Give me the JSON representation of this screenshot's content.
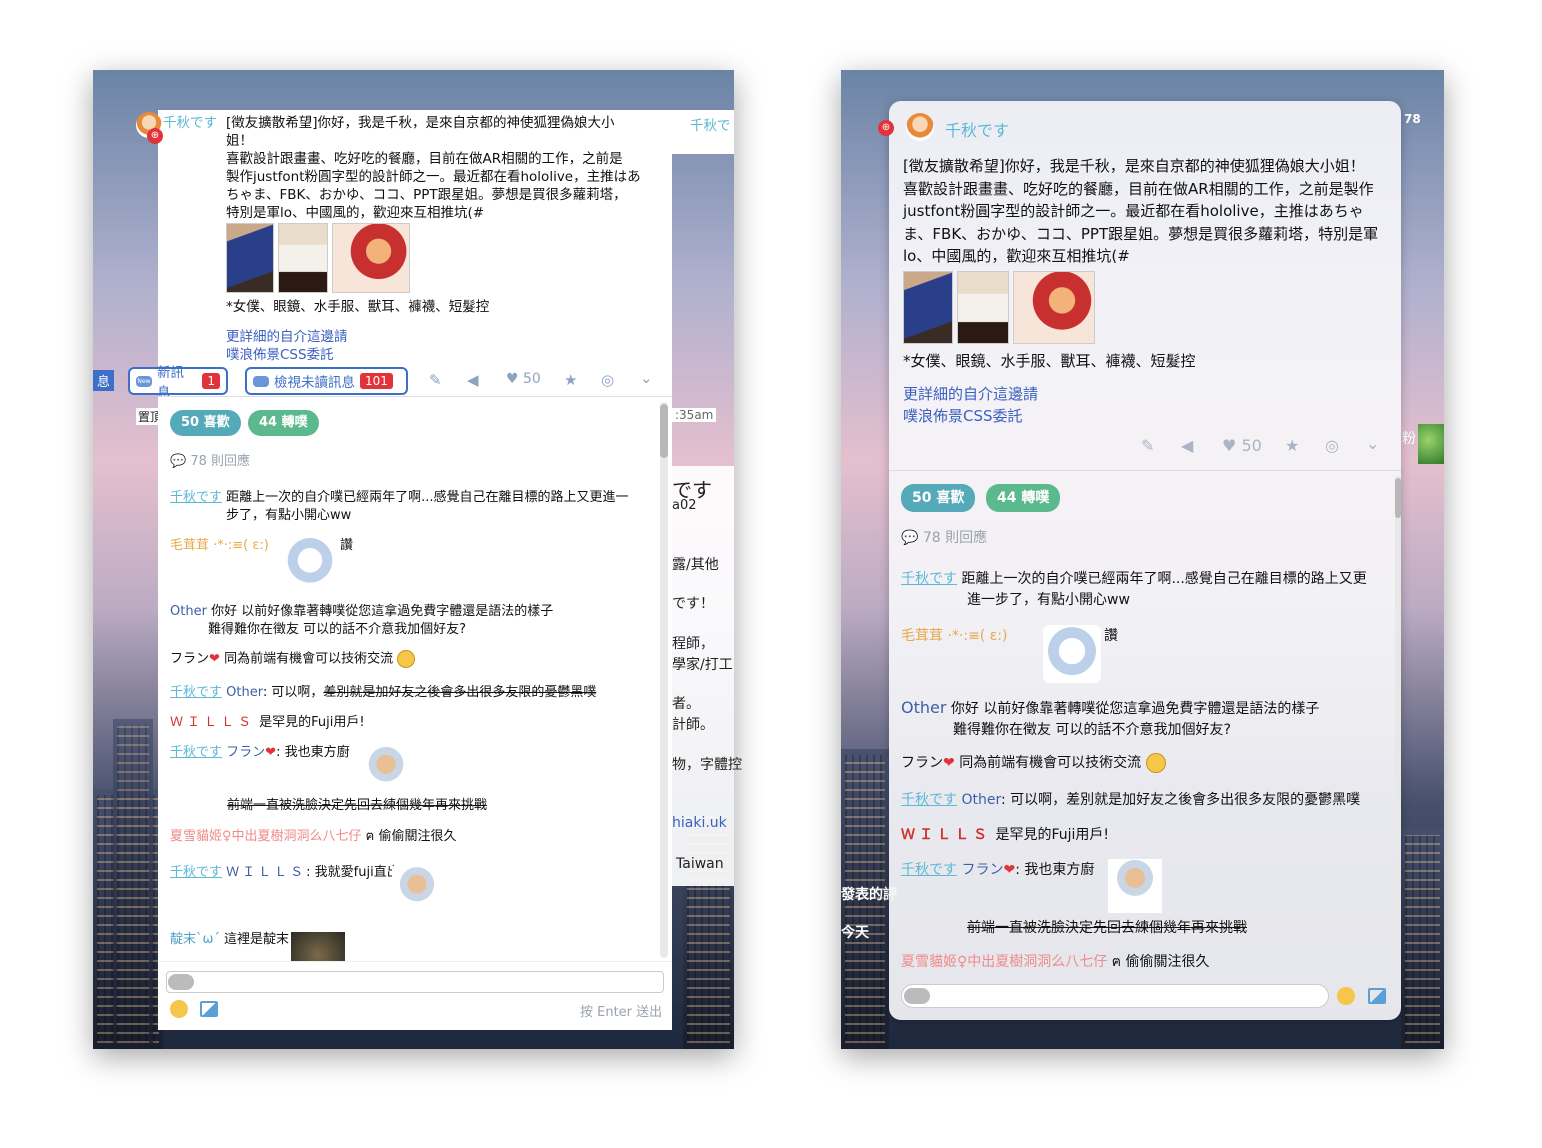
{
  "post": {
    "author": "千秋です",
    "text_left": [
      "[徵友擴散希望]你好，我是千秋，是來自京都的神使狐狸偽娘大小",
      "姐！",
      "喜歡設計跟畫畫、吃好吃的餐廳，目前在做AR相關的工作，之前是",
      "製作justfont粉圓字型的設計師之一。最近都在看hololive，主推はあ",
      "ちゃま、FBK、おかゆ、ココ、PPT跟星姐。夢想是買很多蘿莉塔，",
      "特別是軍lo、中國風的，歡迎來互相推坑(#"
    ],
    "text_right": [
      "[徵友擴散希望]你好，我是千秋，是來自京都的神使狐狸偽娘大小姐！",
      "喜歡設計跟畫畫、吃好吃的餐廳，目前在做AR相關的工作，之前是製作",
      "justfont粉圓字型的設計師之一。最近都在看hololive，主推はあちゃ",
      "ま、FBK、おかゆ、ココ、PPT跟星姐。夢想是買很多蘿莉塔，特別是軍",
      "lo、中國風的，歡迎來互相推坑(#"
    ],
    "likes_text": "*女僕、眼鏡、水手服、獸耳、褲襪、短髮控",
    "link1": "更詳細的自介這邊請",
    "link2": "噗浪佈景CSS委託",
    "like_count": "50"
  },
  "toolbar": {
    "new_msg_label": "新訊息",
    "new_msg_count": "1",
    "unread_label": "檢視未讀訊息",
    "unread_count": "101",
    "new_icon_text": "New"
  },
  "stats": {
    "likes_tag": "50 喜歡",
    "replurks_tag": "44 轉噗",
    "responses": "78 則回應"
  },
  "responses": [
    {
      "name": "千秋です",
      "text": "距離上一次的自介噗已經兩年了啊...感覺自己在離目標的路上又更進一步了，有點小開心ww",
      "text_a": "距離上一次的自介噗已經兩年了啊...感覺自己在離目標的路上又更進一",
      "text_b": "步了，有點小開心ww",
      "text_ra": "距離上一次的自介噗已經兩年了啊...感覺自己在離目標的路上又更",
      "text_rb": "進一步了，有點小開心ww"
    },
    {
      "name": "毛茸茸 ·*·:≡( ε:)",
      "text": "讚"
    },
    {
      "name": "Other",
      "text_a": "你好 以前好像靠著轉噗從您這拿過免費字體還是語法的樣子",
      "text_b": "難得難你在徵友 可以的話不介意我加個好友?"
    },
    {
      "name": "フラン",
      "text": "同為前端有機會可以技術交流"
    },
    {
      "name": "千秋です",
      "target": "Other",
      "text_plain": ": 可以啊，",
      "text_strike": "差別就是加好友之後會多出很多友限的憂鬱黑噗"
    },
    {
      "name": "ＷＩＬＬＳ",
      "text": "是罕見的Fuji用戶!"
    },
    {
      "name": "千秋です",
      "target": "フラン",
      "text": ": 我也東方廚",
      "text_strike": "前端一直被洗臉決定先回去練個幾年再來挑戰"
    },
    {
      "name": "夏雪貓姬♀中出夏樹洞洞么八七仔",
      "text": "偷偷關注很久"
    },
    {
      "name": "千秋です",
      "target": "ＷＩＬＬＳ",
      "text": ": 我就愛fuji直出"
    },
    {
      "name": "靛末`ω´",
      "text": "這裡是靛末"
    }
  ],
  "input": {
    "hint": "按 Enter 送出"
  },
  "fragments_left": {
    "f_time": ":35am",
    "f_desu": "です",
    "f_a02": "a02",
    "f_other": "露/其他",
    "f_desu2": "です！",
    "f_prog": "程師，",
    "f_study": "學家/打工",
    "f_sha": "者。",
    "f_design": "計師。",
    "f_font": "物，字體控",
    "f_uk": "hiaki.uk",
    "f_tw": "Taiwan",
    "f_top": "千秋で",
    "f_pin": "置頂",
    "f_msg": "息"
  },
  "fragments_right": {
    "f_78": "78",
    "f_fen": "粉",
    "f_biao": "發表的評",
    "f_tian": "今天"
  }
}
